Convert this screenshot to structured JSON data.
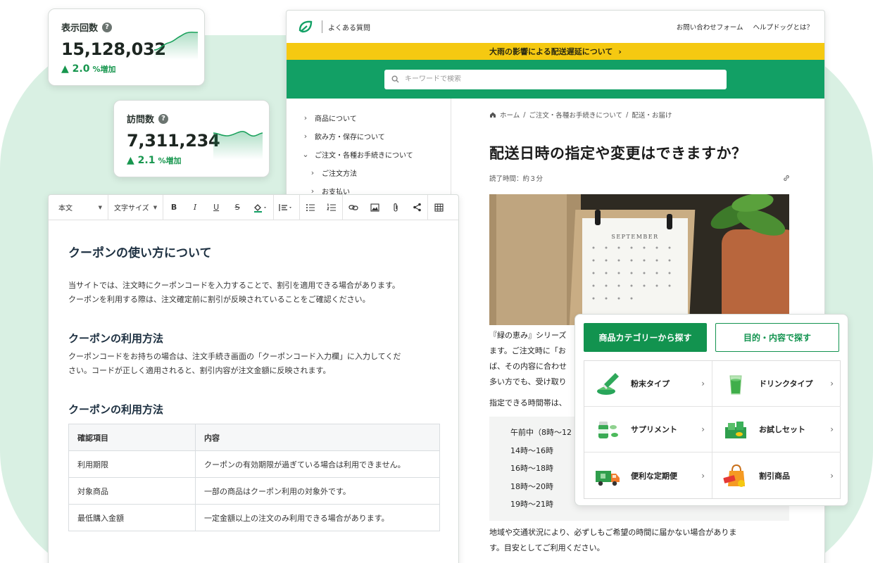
{
  "stats": [
    {
      "title": "表示回数",
      "value": "15,128,032",
      "change": "▲ 2.0",
      "unit": "%増加"
    },
    {
      "title": "訪問数",
      "value": "7,311,234",
      "change": "▲ 2.1",
      "unit": "%増加"
    }
  ],
  "help": {
    "brand_label": "よくある質問",
    "top_links": [
      "お問い合わせフォーム",
      "ヘルプドッグとは？"
    ],
    "banner": "大雨の影響による配送遅延について",
    "search_placeholder": "キーワードで検索",
    "nav": [
      {
        "label": "商品について",
        "expanded": false,
        "level": 0
      },
      {
        "label": "飲み方・保存について",
        "expanded": false,
        "level": 0
      },
      {
        "label": "ご注文・各種お手続きについて",
        "expanded": true,
        "level": 0
      },
      {
        "label": "ご注文方法",
        "expanded": false,
        "level": 1
      },
      {
        "label": "お支払い",
        "expanded": false,
        "level": 1
      }
    ],
    "breadcrumb": [
      "ホーム",
      "ご注文・各種お手続きについて",
      "配送・お届け"
    ],
    "title": "配送日時の指定や変更はできますか？",
    "read_time": "読了時間：約３分",
    "photo_text": "SEPTEMBER",
    "paragraph_lines": [
      "『緑の恵み』シリーズ",
      "ます。ご注文時に「お",
      "ば、その内容に合わせ",
      "多い方でも、受け取り"
    ],
    "time_intro": "指定できる時間帯は、",
    "time_slots": [
      "午前中（8時〜12",
      "14時〜16時",
      "16時〜18時",
      "18時〜20時",
      "19時〜21時"
    ],
    "footer_lines": [
      "地域や交通状況により、必ずしもご希望の時間に届かない場合がありま",
      "す。目安としてご利用ください。"
    ]
  },
  "editor": {
    "toolbar": {
      "format": "本文",
      "font_size": "文字サイズ"
    },
    "heading": "クーポンの使い方について",
    "intro": [
      "当サイトでは、注文時にクーポンコードを入力することで、割引を適用できる場合があります。",
      "クーポンを利用する際は、注文確定前に割引が反映されていることをご確認ください。"
    ],
    "section1_heading": "クーポンの利用方法",
    "section1_text": [
      "クーポンコードをお持ちの場合は、注文手続き画面の「クーポンコード入力欄」に入力してくだ",
      "さい。コードが正しく適用されると、割引内容が注文金額に反映されます。"
    ],
    "section2_heading": "クーポンの利用方法",
    "table": {
      "headers": [
        "確認項目",
        "内容"
      ],
      "rows": [
        [
          "利用期限",
          "クーポンの有効期限が過ぎている場合は利用できません。"
        ],
        [
          "対象商品",
          "一部の商品はクーポン利用の対象外です。"
        ],
        [
          "最低購入金額",
          "一定金額以上の注文のみ利用できる場合があります。"
        ]
      ]
    }
  },
  "category": {
    "tab_active": "商品カテゴリーから探す",
    "tab_inactive": "目的・内容で探す",
    "items": [
      {
        "label": "粉末タイプ",
        "icon": "powder-icon"
      },
      {
        "label": "ドリンクタイプ",
        "icon": "drink-icon"
      },
      {
        "label": "サプリメント",
        "icon": "supplement-icon"
      },
      {
        "label": "お試しセット",
        "icon": "trial-set-icon"
      },
      {
        "label": "便利な定期便",
        "icon": "delivery-truck-icon"
      },
      {
        "label": "割引商品",
        "icon": "sale-bag-icon"
      }
    ]
  },
  "colors": {
    "brand_green": "#12a065",
    "banner_yellow": "#f5c911",
    "background_mint": "#d9f0e3"
  }
}
